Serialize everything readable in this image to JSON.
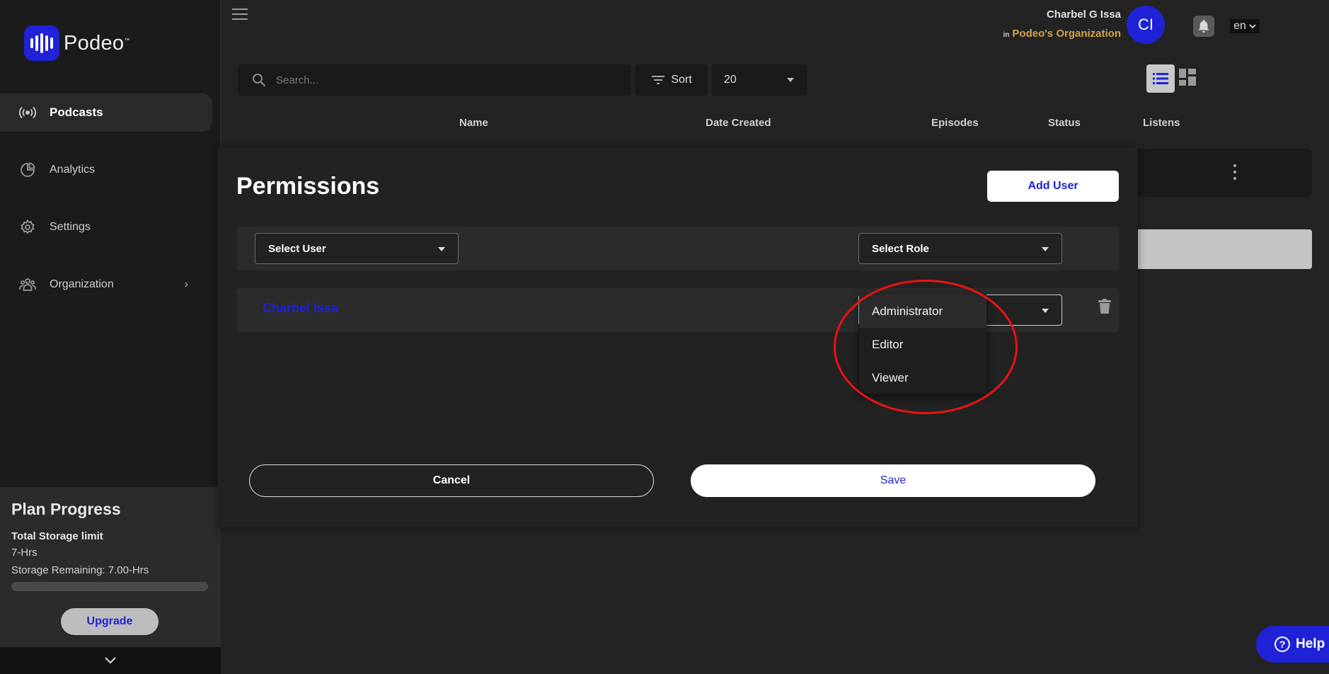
{
  "app": {
    "brand": "Podeo",
    "brand_color": "#1f22d6"
  },
  "sidebar": {
    "items": [
      {
        "label": "Podcasts",
        "icon": "broadcast-icon",
        "active": true
      },
      {
        "label": "Analytics",
        "icon": "pie-chart-icon"
      },
      {
        "label": "Settings",
        "icon": "gear-icon"
      },
      {
        "label": "Organization",
        "icon": "people-icon",
        "has_submenu": true
      }
    ],
    "plan": {
      "title": "Plan Progress",
      "storage_label": "Total Storage limit",
      "storage_limit": "7-Hrs",
      "remaining": "Storage Remaining: 7.00-Hrs",
      "usage_fraction": 0.0,
      "upgrade_label": "Upgrade"
    }
  },
  "header": {
    "user_name": "Charbel G Issa",
    "org_prefix": "in",
    "org_name": "Podeo's Organization",
    "avatar_initials": "CI",
    "language": "en"
  },
  "toolbar": {
    "search_placeholder": "Search...",
    "sort_label": "Sort",
    "per_page": "20"
  },
  "table": {
    "columns": [
      "Name",
      "Date Created",
      "Episodes",
      "Status",
      "Listens"
    ]
  },
  "modal": {
    "title": "Permissions",
    "add_user_label": "Add User",
    "select_user_label": "Select User",
    "select_role_label": "Select Role",
    "user_entry": "Charbel Issa",
    "cancel_label": "Cancel",
    "save_label": "Save",
    "role_options": [
      "Administrator",
      "Editor",
      "Viewer"
    ],
    "highlighted_option": "Administrator"
  },
  "help_label": "Help"
}
